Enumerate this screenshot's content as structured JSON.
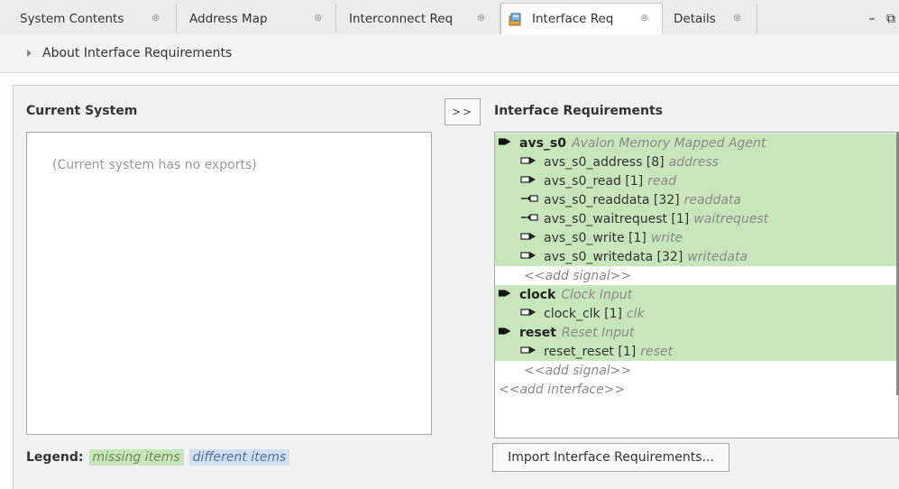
{
  "tabs": [
    {
      "label": "System Contents",
      "close": "⊗"
    },
    {
      "label": "Address Map",
      "close": "⊗"
    },
    {
      "label": "Interconnect Req",
      "close": "⊗"
    },
    {
      "label": "Interface Req",
      "close": "⊗",
      "active": true
    },
    {
      "label": "Details",
      "close": "⊗"
    }
  ],
  "window_controls": "– ⧉",
  "about": {
    "label": "About Interface Requirements"
  },
  "current_system": {
    "title": "Current System",
    "empty_text": "(Current system has no exports)"
  },
  "transfer_button": {
    "label": ">>"
  },
  "interface_requirements": {
    "title": "Interface Requirements",
    "rows": [
      {
        "kind": "interface",
        "name": "avs_s0",
        "hint": "Avalon Memory Mapped Agent",
        "status": "missing"
      },
      {
        "kind": "signal",
        "name": "avs_s0_address [8]",
        "hint": "address",
        "direction": "in",
        "status": "missing"
      },
      {
        "kind": "signal",
        "name": "avs_s0_read [1]",
        "hint": "read",
        "direction": "in",
        "status": "missing"
      },
      {
        "kind": "signal",
        "name": "avs_s0_readdata [32]",
        "hint": "readdata",
        "direction": "out",
        "status": "missing"
      },
      {
        "kind": "signal",
        "name": "avs_s0_waitrequest [1]",
        "hint": "waitrequest",
        "direction": "out",
        "status": "missing"
      },
      {
        "kind": "signal",
        "name": "avs_s0_write [1]",
        "hint": "write",
        "direction": "in",
        "status": "missing"
      },
      {
        "kind": "signal",
        "name": "avs_s0_writedata [32]",
        "hint": "writedata",
        "direction": "in",
        "status": "missing"
      },
      {
        "kind": "add-signal",
        "name": "<<add signal>>"
      },
      {
        "kind": "interface",
        "name": "clock",
        "hint": "Clock Input",
        "status": "missing"
      },
      {
        "kind": "signal",
        "name": "clock_clk [1]",
        "hint": "clk",
        "direction": "in",
        "status": "missing"
      },
      {
        "kind": "interface",
        "name": "reset",
        "hint": "Reset Input",
        "status": "missing"
      },
      {
        "kind": "signal",
        "name": "reset_reset [1]",
        "hint": "reset",
        "direction": "in",
        "status": "missing"
      },
      {
        "kind": "add-signal",
        "name": "<<add signal>>"
      },
      {
        "kind": "add-interface",
        "name": "<<add interface>>"
      }
    ]
  },
  "legend": {
    "label": "Legend:",
    "missing": "missing items",
    "different": "different items"
  },
  "import_button": {
    "label": "Import Interface Requirements..."
  },
  "colors": {
    "missing_bg": "#c8e6bb",
    "different_bg": "#cfe0f3"
  }
}
